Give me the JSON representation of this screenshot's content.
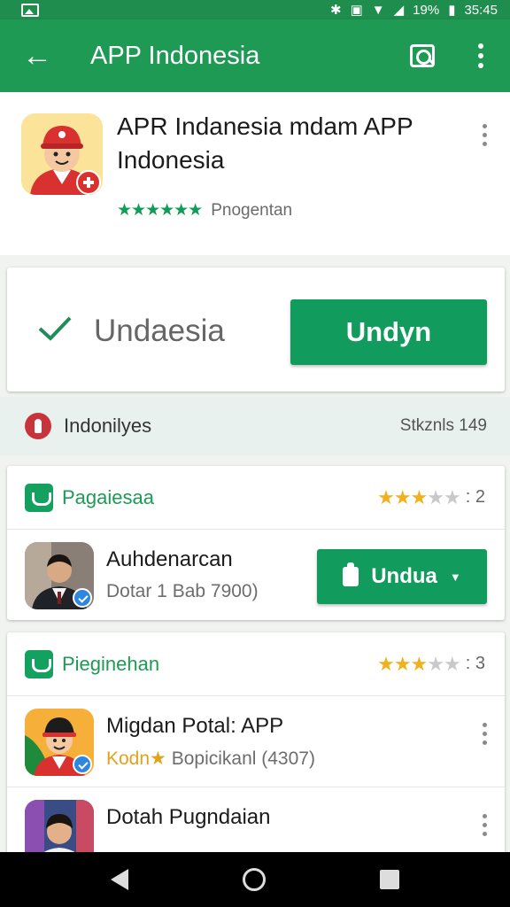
{
  "status_bar": {
    "battery": "19%",
    "time": "35:45"
  },
  "app_bar": {
    "title": "APP Indonesia"
  },
  "app": {
    "name": "APR Indanesia mdam APP Indonesia",
    "rating_stars": "★★★★★★",
    "developer": "Pnogentan"
  },
  "install": {
    "status": "Undaesia",
    "button_label": "Undyn"
  },
  "info": {
    "label": "Indonilyes",
    "count": "Stkznls 149"
  },
  "section1": {
    "label": "Pagaiesaa",
    "stars_on": "★★★",
    "stars_half": "★",
    "stars_off": "★",
    "score": ": 2",
    "item": {
      "title": "Auhdenarcan",
      "subtitle": "Dotar 1 Bab    7900)",
      "button_label": "Undua"
    }
  },
  "section2": {
    "label": "Pieginehan",
    "stars_on": "★★★",
    "stars_half": "★",
    "stars_off": "★",
    "score": ": 3",
    "items": [
      {
        "title": "Migdan Potal: APP",
        "sub_gold": "Kodn★",
        "sub_rest": " Bopicikanl (4307)"
      },
      {
        "title": "Dotah Pugndaian"
      }
    ]
  },
  "colors": {
    "primary": "#1e9a55",
    "button": "#119c5e",
    "star_gold": "#f2b01d"
  }
}
